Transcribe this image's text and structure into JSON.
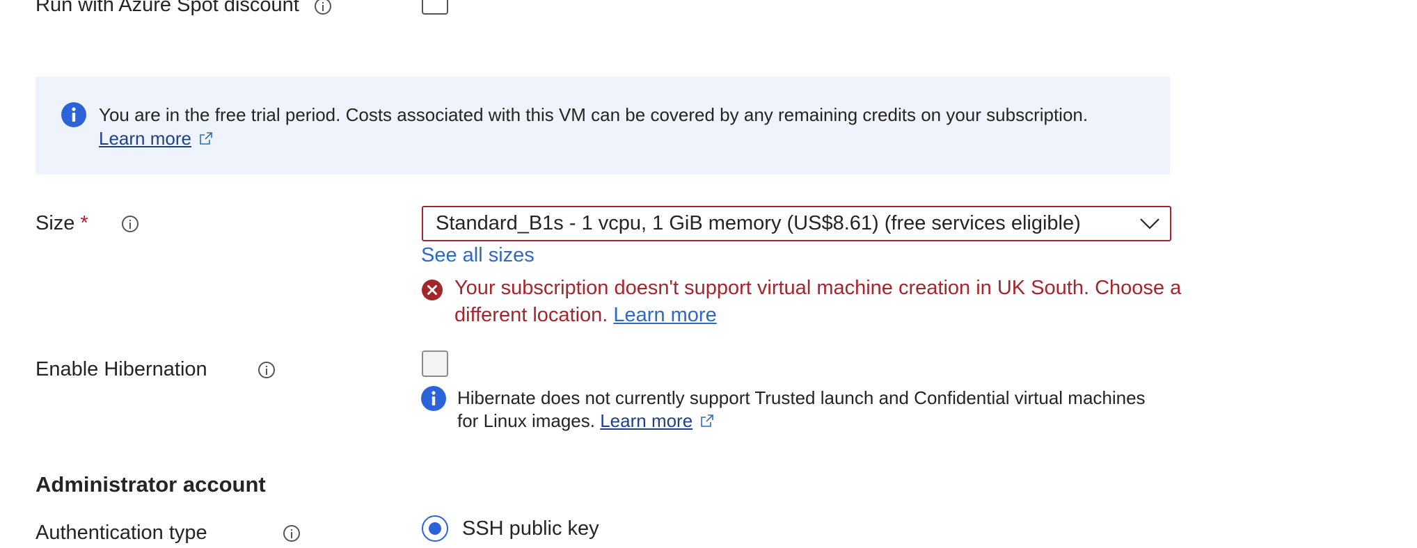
{
  "spot": {
    "label": "Run with Azure Spot discount"
  },
  "banner": {
    "text": "You are in the free trial period. Costs associated with this VM can be covered by any remaining credits on your subscription.",
    "link": "Learn more"
  },
  "size": {
    "label": "Size",
    "required_marker": "*",
    "selected": "Standard_B1s - 1 vcpu, 1 GiB memory (US$8.61)  (free services eligible)",
    "see_all": "See all sizes",
    "error_text": "Your subscription doesn't support virtual machine creation in UK South. Choose a different location.",
    "error_link": "Learn more"
  },
  "hibernation": {
    "label": "Enable Hibernation",
    "info_text": "Hibernate does not currently support Trusted launch and Confidential virtual machines for Linux images.",
    "info_link": "Learn more"
  },
  "admin": {
    "title": "Administrator account",
    "auth_label": "Authentication type",
    "auth_option": "SSH public key"
  },
  "colors": {
    "error": "#a4262c",
    "link": "#2d69c4",
    "info": "#2c63d8",
    "banner_bg": "#eff4fc"
  }
}
